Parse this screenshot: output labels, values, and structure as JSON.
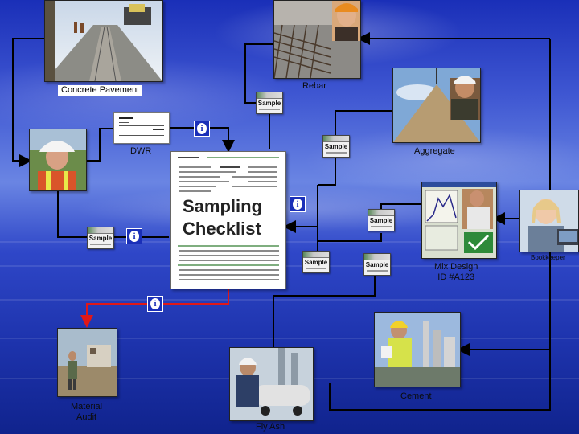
{
  "nodes": {
    "concrete_pavement": "Concrete   Pavement",
    "rebar": "Rebar",
    "dwr": "DWR",
    "aggregate": "Aggregate",
    "bookkeeper": "Bookkeeper",
    "mix_design_line1": "Mix Design",
    "mix_design_line2": "ID #A123",
    "cement": "Cement",
    "fly_ash": "Fly Ash",
    "material_audit_line1": "Material",
    "material_audit_line2": "Audit"
  },
  "checklist": {
    "line1": "Sampling",
    "line2": "Checklist"
  },
  "sample_tag": "Sample",
  "info_glyph": "i",
  "colors": {
    "connector": "#000000",
    "audit_connector": "#e01818",
    "info_box": "#1a2fb8"
  },
  "icons": {
    "sample_tag": "sample-tag-icon",
    "info": "info-icon"
  }
}
